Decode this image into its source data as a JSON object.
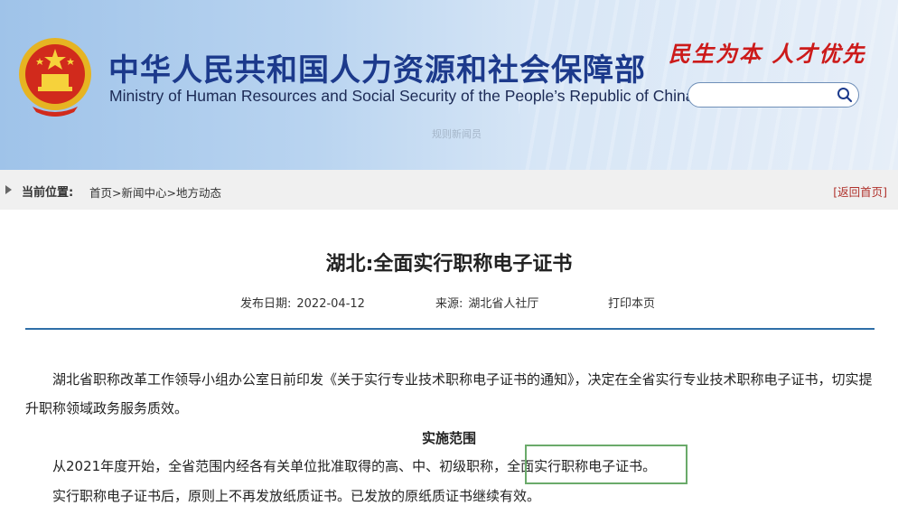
{
  "header": {
    "title_cn": "中华人民共和国人力资源和社会保障部",
    "title_en": "Ministry of Human Resources and Social Security of the People’s Republic of China",
    "slogan": "民生为本 人才优先",
    "search_placeholder": "",
    "faint_text": "规则新闻员"
  },
  "breadcrumb": {
    "label": "当前位置:",
    "items": [
      "首页",
      "新闻中心",
      "地方动态"
    ],
    "separator": ">",
    "back": "[返回首页]"
  },
  "article": {
    "title": "湖北:全面实行职称电子证书",
    "publish_label": "发布日期:",
    "publish_date": "2022-04-12",
    "source_label": "来源:",
    "source": "湖北省人社厅",
    "print": "打印本页",
    "para1": "　　湖北省职称改革工作领导小组办公室日前印发《关于实行专业技术职称电子证书的通知》，决定在全省实行专业技术职称电子证书，切实提升职称领域政务服务质效。",
    "subhead": "实施范围",
    "para2": "　　从2021年度开始，全省范围内经各有关单位批准取得的高、中、初级职称，全面实行职称电子证书。",
    "para3": "　　实行职称电子证书后，原则上不再发放纸质证书。已发放的原纸质证书继续有效。"
  },
  "colors": {
    "title_blue": "#1c3a8c",
    "slogan_red": "#cc1a1a",
    "rule_blue": "#2f6fa8",
    "highlight_green": "#6aaa6a"
  }
}
